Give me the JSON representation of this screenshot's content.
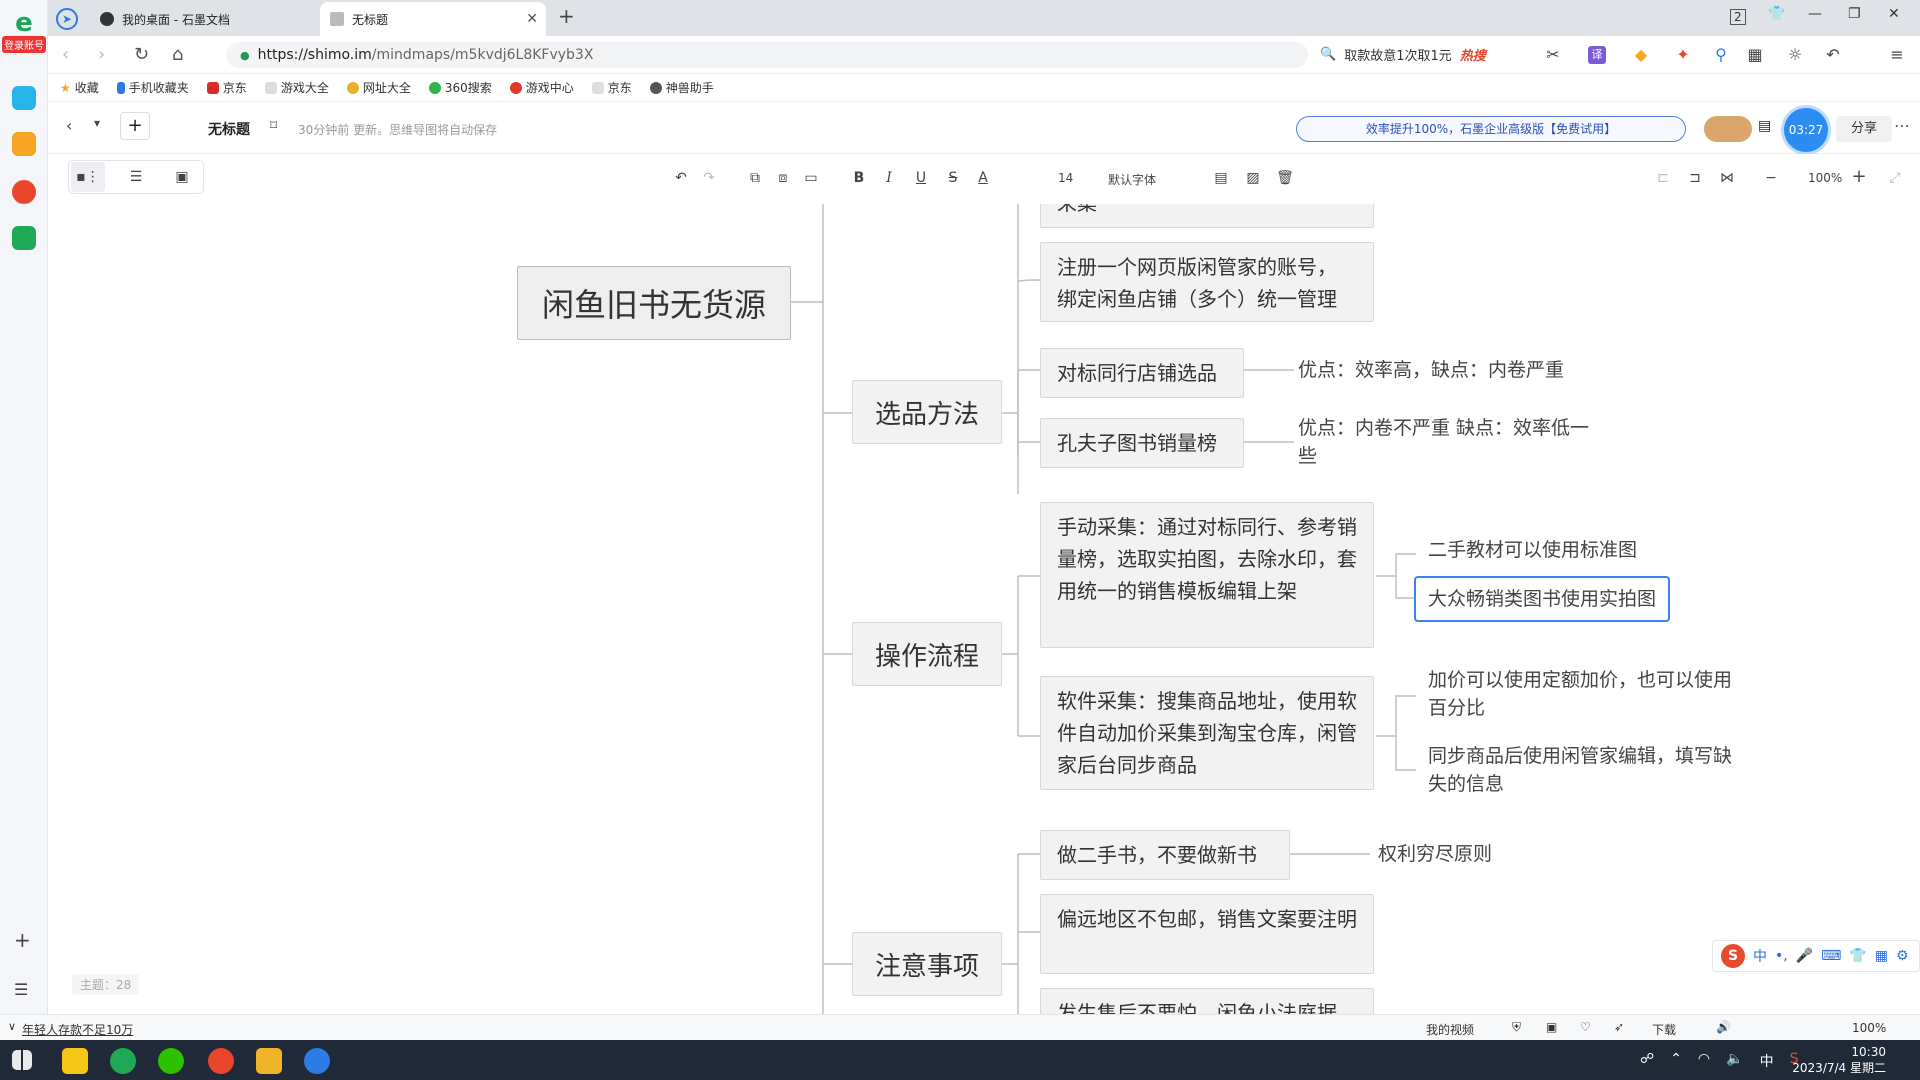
{
  "rail": {
    "badge": "登录账号"
  },
  "tabs": [
    {
      "label": "我的桌面 - 石墨文档"
    },
    {
      "label": "无标题"
    }
  ],
  "address": {
    "scheme_host": "https://shimo.im",
    "path": "/mindmaps/m5kvdj6L8KFvyb3X"
  },
  "search": {
    "text": "取款故意1次取1元",
    "hot": "热搜"
  },
  "bookmarks": [
    "收藏",
    "手机收藏夹",
    "京东",
    "游戏大全",
    "网址大全",
    "360搜索",
    "游戏中心",
    "京东",
    "神兽助手"
  ],
  "doc": {
    "title": "无标题",
    "saved": "30分钟前 更新。思维导图将自动保存",
    "promo": "效率提升100%，石墨企业高级版【免费试用】",
    "timer": "03:27",
    "share": "分享"
  },
  "toolbar": {
    "font_size": "14",
    "font_family": "默认字体",
    "zoom": "100%"
  },
  "mindmap": {
    "root": "闲鱼旧书无货源",
    "top_partial": "采集",
    "register": "注册一个网页版闲管家的账号，\n绑定闲鱼店铺（多个）统一管理",
    "branches": {
      "xuanpin": {
        "label": "选品方法",
        "child1": "对标同行店铺选品",
        "leaf1": "优点：效率高，缺点：内卷严重",
        "child2": "孔夫子图书销量榜",
        "leaf2": "优点：内卷不严重 缺点：效率低一些"
      },
      "caozuo": {
        "label": "操作流程",
        "child1": "手动采集：通过对标同行、参考销量榜，选取实拍图，去除水印，套用统一的销售模板编辑上架",
        "leaf1a": "二手教材可以使用标准图",
        "leaf1b": "大众畅销类图书使用实拍图",
        "child2": "软件采集：搜集商品地址，使用软件自动加价采集到淘宝仓库，闲管家后台同步商品",
        "leaf2a": "加价可以使用定额加价，也可以使用百分比",
        "leaf2b": "同步商品后使用闲管家编辑，填写缺失的信息"
      },
      "zhuyi": {
        "label": "注意事项",
        "child1": "做二手书，不要做新书",
        "leaf1": "权利穷尽原则",
        "child2": "偏远地区不包邮，销售文案要注明",
        "child3": "发生售后不要怕，闲鱼小法庭据"
      }
    },
    "topic_count": "主题：28"
  },
  "ime": {
    "label": "中"
  },
  "status": {
    "news": "年轻人存款不足10万",
    "video": "我的视频",
    "download": "下载",
    "zoom": "100%"
  },
  "taskbar": {
    "time": "10:30",
    "date": "2023/7/4 星期二",
    "ime": "中"
  }
}
